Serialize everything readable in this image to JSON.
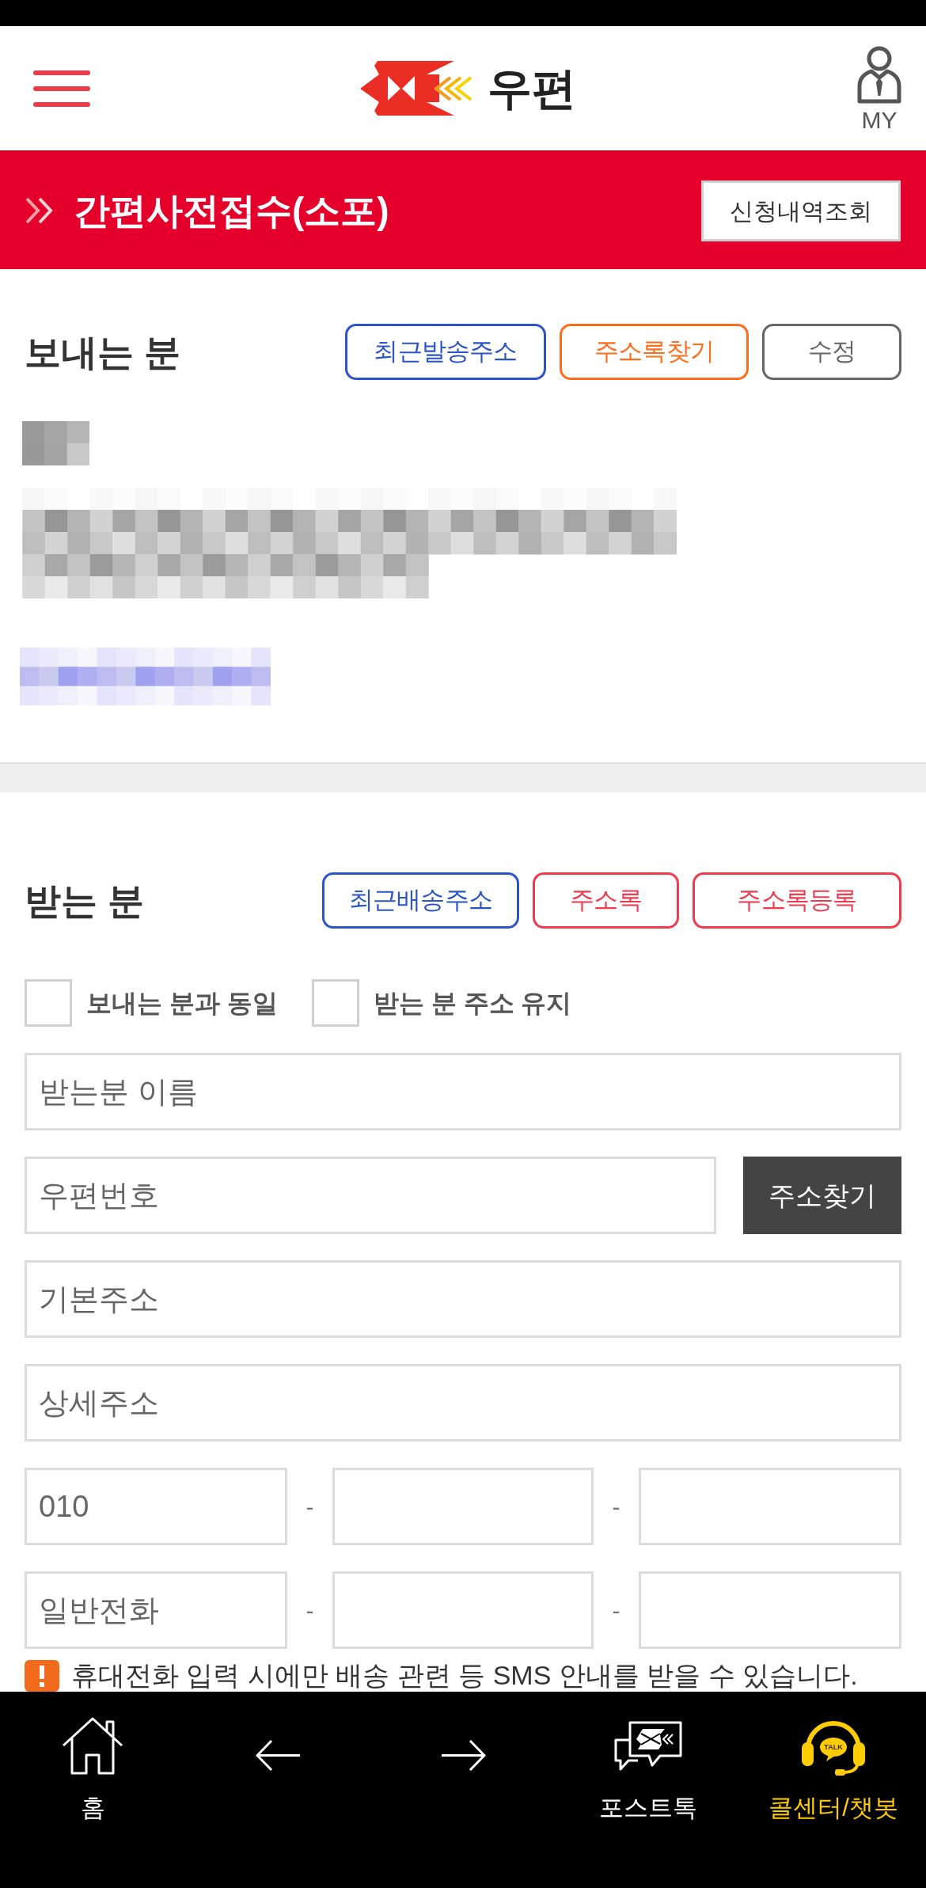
{
  "header": {
    "logo_text": "우편",
    "my_label": "MY"
  },
  "banner": {
    "title": "간편사전접수(소포)",
    "button": "신청내역조회"
  },
  "sender": {
    "heading": "보내는 분",
    "buttons": [
      {
        "label": "최근발송주소",
        "color": "#2b54c9"
      },
      {
        "label": "주소록찾기",
        "color": "#ff6d1a"
      },
      {
        "label": "수정",
        "color": "#666666"
      }
    ]
  },
  "receiver": {
    "heading": "받는 분",
    "buttons": [
      {
        "label": "최근배송주소",
        "color": "#2b54c9"
      },
      {
        "label": "주소록",
        "color": "#f03a4e"
      },
      {
        "label": "주소록등록",
        "color": "#f03a4e"
      }
    ],
    "options": [
      {
        "label": "보내는 분과 동일",
        "checked": false
      },
      {
        "label": "받는 분 주소 유지",
        "checked": false
      }
    ],
    "name_field": {
      "placeholder": "받는분 이름"
    },
    "postcode_field": {
      "placeholder": "우편번호"
    },
    "search_button": "주소찾기",
    "address_fields": [
      {
        "placeholder": "기본주소"
      },
      {
        "placeholder": "상세주소"
      }
    ],
    "phone_rows": [
      {
        "first": {
          "value": "010"
        },
        "separators": [
          "-",
          "-"
        ]
      },
      {
        "first": {
          "placeholder": "일반전화"
        },
        "separators": [
          "-",
          "-"
        ]
      }
    ],
    "notice": "휴대전화 입력 시에만 배송 관련 등 SMS 안내를 받을 수 있습니다."
  },
  "bottom_nav": [
    {
      "kind": "home",
      "label": "홈",
      "color": "#ffffff"
    },
    {
      "kind": "back",
      "color": "#ffffff"
    },
    {
      "kind": "forward",
      "color": "#ffffff"
    },
    {
      "kind": "posttalk",
      "label": "포스트톡",
      "color": "#ffffff"
    },
    {
      "kind": "callcenter",
      "label": "콜센터/챗봇",
      "badge": "TALK",
      "color": "#ffcc00"
    }
  ]
}
